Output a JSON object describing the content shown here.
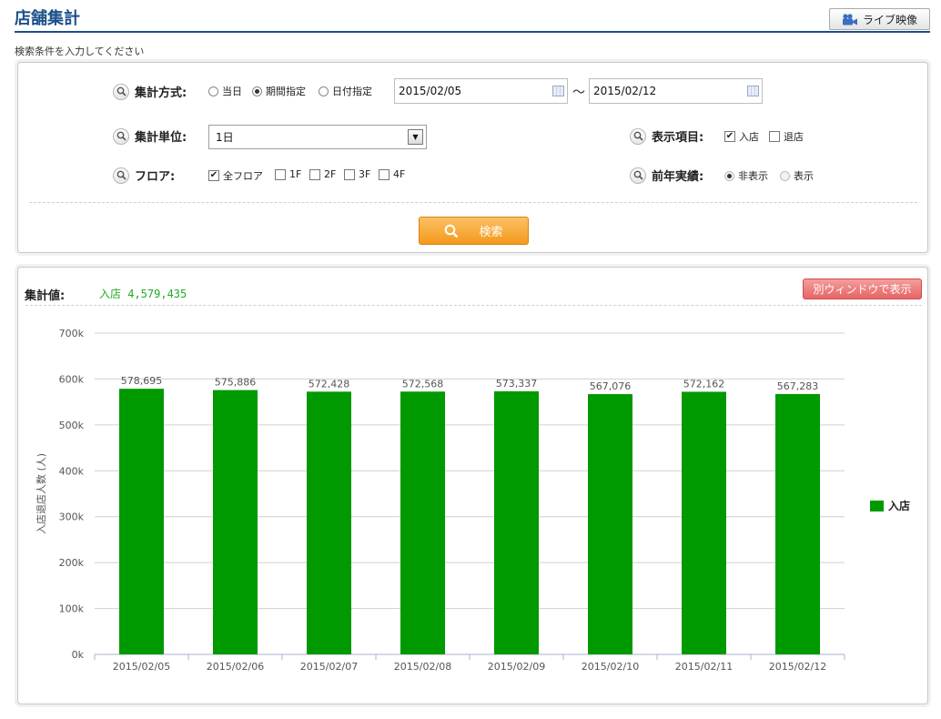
{
  "header": {
    "title": "店舗集計",
    "live_button_label": "ライブ映像",
    "instruction": "検索条件を入力してください"
  },
  "search": {
    "aggregation_method": {
      "label": "集計方式:",
      "options": [
        {
          "label": "当日",
          "selected": false
        },
        {
          "label": "期間指定",
          "selected": true
        },
        {
          "label": "日付指定",
          "selected": false
        }
      ],
      "date_from": "2015/02/05",
      "date_separator": "～",
      "date_to": "2015/02/12"
    },
    "aggregation_unit": {
      "label": "集計単位:",
      "selected": "1日"
    },
    "display_items": {
      "label": "表示項目:",
      "options": [
        {
          "label": "入店",
          "checked": true
        },
        {
          "label": "退店",
          "checked": false
        }
      ]
    },
    "floor": {
      "label": "フロア:",
      "options": [
        {
          "label": "全フロア",
          "checked": true
        },
        {
          "label": "1F",
          "checked": false
        },
        {
          "label": "2F",
          "checked": false
        },
        {
          "label": "3F",
          "checked": false
        },
        {
          "label": "4F",
          "checked": false
        }
      ]
    },
    "previous_year": {
      "label": "前年実績:",
      "options": [
        {
          "label": "非表示",
          "selected": true
        },
        {
          "label": "表示",
          "selected": false
        }
      ]
    },
    "search_button_label": "検索"
  },
  "result": {
    "summary_label": "集計値:",
    "summary_value": "入店 4,579,435",
    "popup_button_label": "別ウィンドウで表示"
  },
  "colors": {
    "title_blue": "#1b4f8a",
    "bar_green": "#009900",
    "summary_green": "#22aa22",
    "search_orange": "#f39a1c",
    "popup_red": "#e66464"
  },
  "chart_data": {
    "type": "bar",
    "categories": [
      "2015/02/05",
      "2015/02/06",
      "2015/02/07",
      "2015/02/08",
      "2015/02/09",
      "2015/02/10",
      "2015/02/11",
      "2015/02/12"
    ],
    "series": [
      {
        "name": "入店",
        "color": "#009900",
        "values": [
          578695,
          575886,
          572428,
          572568,
          573337,
          567076,
          572162,
          567283
        ],
        "labels": [
          "578,695",
          "575,886",
          "572,428",
          "572,568",
          "573,337",
          "567,076",
          "572,162",
          "567,283"
        ]
      }
    ],
    "ylabel": "入店退店人数 (人)",
    "ylim": [
      0,
      700000
    ],
    "yticks": [
      0,
      100000,
      200000,
      300000,
      400000,
      500000,
      600000,
      700000
    ],
    "ytick_labels": [
      "0k",
      "100k",
      "200k",
      "300k",
      "400k",
      "500k",
      "600k",
      "700k"
    ],
    "grid": true,
    "legend_position": "right"
  }
}
